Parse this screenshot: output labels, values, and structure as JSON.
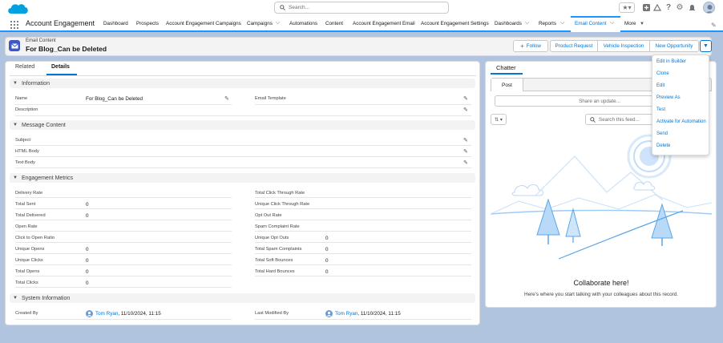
{
  "global": {
    "search_placeholder": "Search...",
    "icons": [
      "favorites-star-icon",
      "add-icon",
      "trailhead-icon",
      "help-icon",
      "setup-gear-icon",
      "notifications-bell-icon",
      "avatar"
    ]
  },
  "nav": {
    "app_name": "Account Engagement",
    "items": [
      "Dashboard",
      "Prospects",
      "Account Engagement Campaigns",
      "Campaigns",
      "Automations",
      "Content",
      "Account Engagement Email",
      "Account Engagement Settings",
      "Dashboards",
      "Reports",
      "Email Content",
      "More"
    ]
  },
  "record": {
    "object_label": "Email Content",
    "title": "For Blog_Can be Deleted",
    "actions": [
      "Follow",
      "Product Request",
      "Vehicle Inspection",
      "New Opportunity"
    ],
    "follow_icon": "+"
  },
  "tabs": {
    "related": "Related",
    "details": "Details"
  },
  "sections": {
    "information": "Information",
    "message_content": "Message Content",
    "engagement_metrics": "Engagement Metrics",
    "system_information": "System Information"
  },
  "fields": {
    "name_label": "Name",
    "name_value": "For Blog_Can be Deleted",
    "email_template_label": "Email Template",
    "description_label": "Description",
    "subject_label": "Subject",
    "html_body_label": "HTML Body",
    "text_body_label": "Text Body",
    "delivery_rate": "Delivery Rate",
    "total_sent": "Total Sent",
    "total_sent_value": "0",
    "total_delivered": "Total Delivered",
    "total_delivered_value": "0",
    "open_rate": "Open Rate",
    "click_to_open_ratio": "Click to Open Ratio",
    "unique_opens": "Unique Opens",
    "unique_opens_value": "0",
    "unique_clicks": "Unique Clicks",
    "unique_clicks_value": "0",
    "total_opens": "Total Opens",
    "total_opens_value": "0",
    "total_clicks": "Total Clicks",
    "total_clicks_value": "0",
    "total_click_through_rate": "Total Click Through Rate",
    "unique_click_through_rate": "Unique Click Through Rate",
    "opt_out_rate": "Opt Out Rate",
    "spam_complaint_rate": "Spam Complaint Rate",
    "unique_opt_outs": "Unique Opt Outs",
    "unique_opt_outs_value": "0",
    "total_spam_complaints": "Total Spam Complaints",
    "total_spam_complaints_value": "0",
    "total_soft_bounces": "Total Soft Bounces",
    "total_soft_bounces_value": "0",
    "total_hard_bounces": "Total Hard Bounces",
    "total_hard_bounces_value": "0",
    "created_by_label": "Created By",
    "created_by_user": "Tom Ryan",
    "created_by_date": ", 11/10/2024, 11:15",
    "last_modified_by_label": "Last Modified By",
    "last_modified_by_user": "Tom Ryan",
    "last_modified_by_date": ", 11/10/2024, 11:15"
  },
  "chatter": {
    "title": "Chatter",
    "post_tab": "Post",
    "share_placeholder": "Share an update...",
    "feed_search_placeholder": "Search this feed...",
    "empty_title": "Collaborate here!",
    "empty_subtitle": "Here's where you start talking with your colleagues about this record."
  },
  "action_menu": {
    "items": [
      "Edit in Builder",
      "Clone",
      "Edit",
      "Preview As",
      "Test",
      "Activate for Automation",
      "Send",
      "Delete"
    ]
  },
  "colors": {
    "brand_blue": "#0176d3",
    "nav_accent": "#1b96ff",
    "email_icon_bg": "#3e57c4",
    "page_bg": "#b0c4df"
  }
}
